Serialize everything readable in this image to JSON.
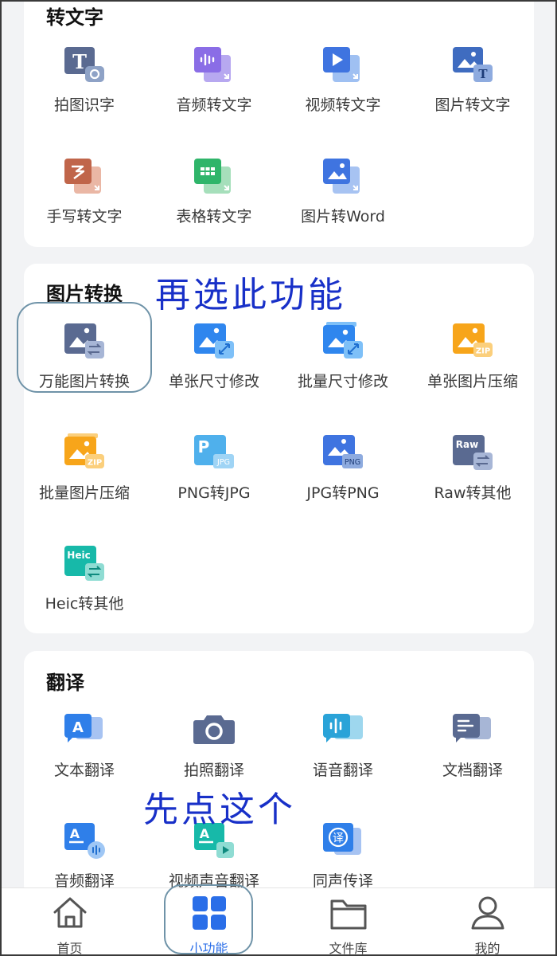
{
  "sections": {
    "text": {
      "title": "转文字",
      "items": [
        {
          "label": "拍图识字",
          "icon": "camera-text-icon"
        },
        {
          "label": "音频转文字",
          "icon": "audio-to-text-icon"
        },
        {
          "label": "视频转文字",
          "icon": "video-to-text-icon"
        },
        {
          "label": "图片转文字",
          "icon": "image-to-text-icon"
        },
        {
          "label": "手写转文字",
          "icon": "handwriting-to-text-icon"
        },
        {
          "label": "表格转文字",
          "icon": "table-to-text-icon"
        },
        {
          "label": "图片转Word",
          "icon": "image-to-word-icon"
        }
      ]
    },
    "image": {
      "title": "图片转换",
      "items": [
        {
          "label": "万能图片转换",
          "icon": "universal-image-convert-icon"
        },
        {
          "label": "单张尺寸修改",
          "icon": "single-resize-icon"
        },
        {
          "label": "批量尺寸修改",
          "icon": "batch-resize-icon"
        },
        {
          "label": "单张图片压缩",
          "icon": "single-compress-icon"
        },
        {
          "label": "批量图片压缩",
          "icon": "batch-compress-icon"
        },
        {
          "label": "PNG转JPG",
          "icon": "png-to-jpg-icon"
        },
        {
          "label": "JPG转PNG",
          "icon": "jpg-to-png-icon"
        },
        {
          "label": "Raw转其他",
          "icon": "raw-convert-icon"
        },
        {
          "label": "Heic转其他",
          "icon": "heic-convert-icon"
        }
      ]
    },
    "translate": {
      "title": "翻译",
      "items": [
        {
          "label": "文本翻译",
          "icon": "text-translate-icon"
        },
        {
          "label": "拍照翻译",
          "icon": "photo-translate-icon"
        },
        {
          "label": "语音翻译",
          "icon": "voice-translate-icon"
        },
        {
          "label": "文档翻译",
          "icon": "document-translate-icon"
        },
        {
          "label": "音频翻译",
          "icon": "audio-translate-icon"
        },
        {
          "label": "视频声音翻译",
          "icon": "video-audio-translate-icon"
        },
        {
          "label": "同声传译",
          "icon": "simultaneous-interpret-icon"
        }
      ]
    }
  },
  "icon_text": {
    "zip": "ZIP",
    "p": "P",
    "jpg": "JPG",
    "png": "PNG",
    "raw": "Raw",
    "heic": "Heic",
    "a": "A",
    "yi": "译"
  },
  "annotations": {
    "select_this": "再选此功能",
    "click_first": "先点这个"
  },
  "tabbar": [
    {
      "label": "首页",
      "icon": "home-icon"
    },
    {
      "label": "小功能",
      "icon": "grid-icon"
    },
    {
      "label": "文件库",
      "icon": "folder-icon"
    },
    {
      "label": "我的",
      "icon": "profile-icon"
    }
  ],
  "colors": {
    "slate": "#5a6a91",
    "blue": "#2f7fe9",
    "orange": "#f7a51a",
    "teal": "#17b9a9",
    "green": "#2fb56a",
    "brick": "#c0654a",
    "purple": "#8a6de6",
    "annotation": "#1830c8",
    "active_tab": "#2a6ee8"
  }
}
